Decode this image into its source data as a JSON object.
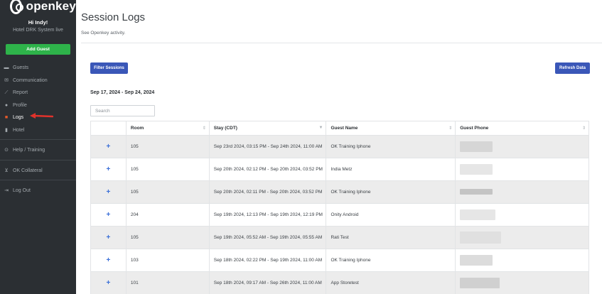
{
  "sidebar": {
    "brand": "openkey",
    "greeting": "Hi Indy!",
    "hotel": "Hotel DRK System live",
    "add_guest": "Add Guest",
    "items": [
      {
        "label": "Guests",
        "icon": "bed-icon"
      },
      {
        "label": "Communication",
        "icon": "envelope-icon"
      },
      {
        "label": "Report",
        "icon": "chart-icon"
      },
      {
        "label": "Profile",
        "icon": "user-icon"
      },
      {
        "label": "Logs",
        "icon": "logs-icon",
        "active": true
      },
      {
        "label": "Hotel",
        "icon": "building-icon"
      },
      {
        "label": "Help / Training",
        "icon": "help-icon"
      },
      {
        "label": "OK Collateral",
        "icon": "cart-icon"
      },
      {
        "label": "Log Out",
        "icon": "logout-icon"
      }
    ]
  },
  "header": {
    "title": "Session Logs",
    "subtitle": "See Openkey activity."
  },
  "toolbar": {
    "filter_label": "Filter Sessions",
    "refresh_label": "Refresh Data",
    "date_range": "Sep 17, 2024 - Sep 24, 2024",
    "search_placeholder": "Search"
  },
  "table": {
    "columns": [
      "",
      "Room",
      "Stay (CDT)",
      "Guest Name",
      "Guest Phone"
    ],
    "rows": [
      {
        "expand": "+",
        "room": "105",
        "stay": "Sep 23rd 2024, 03:15 PM - Sep 24th 2024, 11:00 AM",
        "guest": "OK Training Iphone"
      },
      {
        "expand": "+",
        "room": "105",
        "stay": "Sep 20th 2024, 02:12 PM - Sep 20th 2024, 03:52 PM",
        "guest": "India Metz"
      },
      {
        "expand": "+",
        "room": "105",
        "stay": "Sep 20th 2024, 02:11 PM - Sep 20th 2024, 03:52 PM",
        "guest": "OK Training Iphone"
      },
      {
        "expand": "+",
        "room": "204",
        "stay": "Sep 19th 2024, 12:13 PM - Sep 19th 2024, 12:19 PM",
        "guest": "Onity Android"
      },
      {
        "expand": "+",
        "room": "105",
        "stay": "Sep 19th 2024, 05:52 AM - Sep 19th 2024, 05:55 AM",
        "guest": "Rati Test"
      },
      {
        "expand": "+",
        "room": "103",
        "stay": "Sep 18th 2024, 02:22 PM - Sep 19th 2024, 11:00 AM",
        "guest": "OK Training Iphone"
      },
      {
        "expand": "+",
        "room": "101",
        "stay": "Sep 18th 2024, 09:17 AM - Sep 26th 2024, 11:00 AM",
        "guest": "App Storetest"
      }
    ]
  },
  "colors": {
    "sidebar_bg": "#2b2f33",
    "add_guest": "#2eb34a",
    "primary_button": "#3a57b8",
    "active_arrow": "#e0322b"
  }
}
